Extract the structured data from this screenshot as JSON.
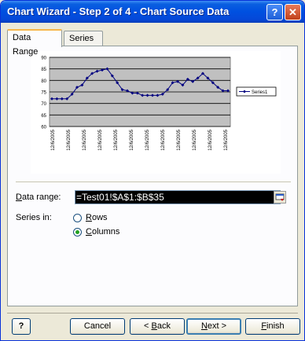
{
  "window": {
    "title": "Chart Wizard - Step 2 of 4 - Chart Source Data",
    "help_glyph": "?",
    "close_glyph": "✕"
  },
  "tabs": [
    {
      "label": "Data Range",
      "active": true
    },
    {
      "label": "Series",
      "active": false
    }
  ],
  "form": {
    "data_range_label": "Data range:",
    "data_range_value": "=Test01!$A$1:$B$35",
    "series_in_label": "Series in:",
    "rows_label": "Rows",
    "columns_label": "Columns",
    "selected": "Columns"
  },
  "buttons": {
    "help": "?",
    "cancel": "Cancel",
    "back": "< Back",
    "next": "Next >",
    "finish": "Finish"
  },
  "chart_data": {
    "type": "line",
    "ylim": [
      60,
      90
    ],
    "yticks": [
      60,
      65,
      70,
      75,
      80,
      85,
      90
    ],
    "y_tick_labels": [
      "60",
      "65",
      "70",
      "75",
      "80",
      "85",
      "90"
    ],
    "x_tick_labels": [
      "12/6/2005",
      "12/6/2005",
      "12/6/2005",
      "12/6/2005",
      "12/6/2005",
      "12/6/2005",
      "12/6/2005",
      "12/6/2005",
      "12/6/2005",
      "12/6/2005",
      "12/6/2005",
      "12/6/2005"
    ],
    "plot_background": "#c0c0c0",
    "grid": true,
    "legend_position": "right",
    "series": [
      {
        "name": "Series1",
        "color": "#000080",
        "values": [
          72,
          72,
          72,
          72,
          74,
          77,
          78,
          81,
          83,
          84,
          84.5,
          85,
          82,
          79,
          76,
          75.5,
          74.5,
          74.5,
          73.5,
          73.5,
          73.5,
          73.5,
          74,
          76,
          79,
          79.5,
          78,
          80.5,
          79.5,
          81,
          83,
          81,
          79,
          77,
          75.5,
          75.5
        ]
      }
    ]
  }
}
